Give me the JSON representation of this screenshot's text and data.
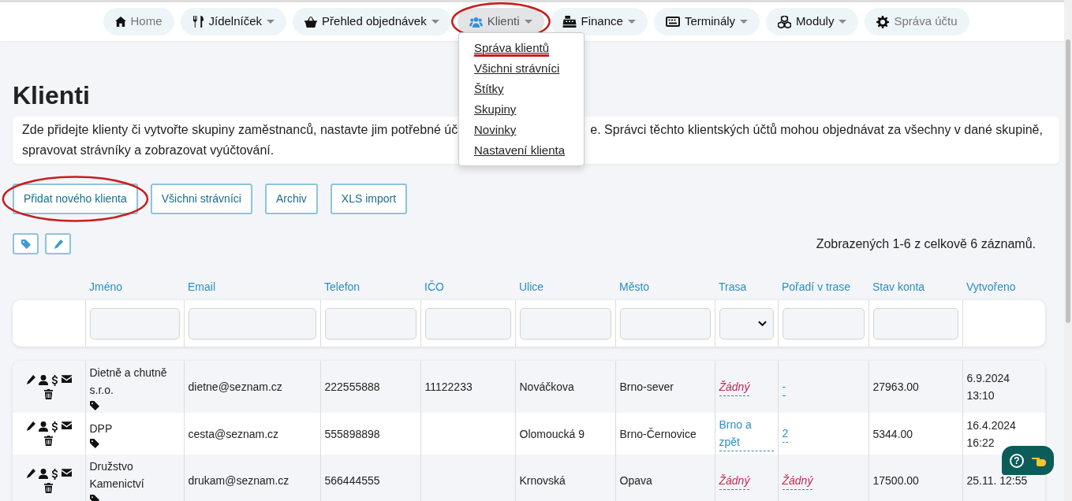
{
  "nav": [
    {
      "label": "Home",
      "dropdown": false,
      "dimmed": true,
      "selected": false,
      "annotated": false
    },
    {
      "label": "Jídelníček",
      "dropdown": true,
      "dimmed": false,
      "selected": false,
      "annotated": false
    },
    {
      "label": "Přehled objednávek",
      "dropdown": true,
      "dimmed": false,
      "selected": false,
      "annotated": false
    },
    {
      "label": "Klienti",
      "dropdown": true,
      "dimmed": false,
      "selected": true,
      "annotated": true
    },
    {
      "label": "Finance",
      "dropdown": true,
      "dimmed": false,
      "selected": false,
      "annotated": false
    },
    {
      "label": "Terminály",
      "dropdown": true,
      "dimmed": false,
      "selected": false,
      "annotated": false
    },
    {
      "label": "Moduly",
      "dropdown": true,
      "dimmed": false,
      "selected": false,
      "annotated": false
    },
    {
      "label": "Správa účtu",
      "dropdown": false,
      "dimmed": true,
      "selected": false,
      "annotated": false
    }
  ],
  "menu": [
    {
      "label": "Správa klientů",
      "annotated": true
    },
    {
      "label": "Všichni strávníci",
      "annotated": false
    },
    {
      "label": "Štítky",
      "annotated": false
    },
    {
      "label": "Skupiny",
      "annotated": false
    },
    {
      "label": "Novinky",
      "annotated": false
    },
    {
      "label": "Nastavení klienta",
      "annotated": false
    }
  ],
  "title": "Klienti",
  "intro": {
    "line1_left": "Zde přidejte klienty či vytvořte skupiny zaměstnanců, nastavte jim potřebné úč",
    "line1_right": "e. Správci těchto klientských účtů mohou objednávat za všechny v dané skupině,",
    "line2": "spravovat strávníky a zobrazovat vyúčtování."
  },
  "buttons": [
    {
      "label": "Přidat nového klienta",
      "annotated": true
    },
    {
      "label": "Všichni strávníci",
      "annotated": false
    },
    {
      "label": "Archiv",
      "annotated": false
    },
    {
      "label": "XLS import",
      "annotated": false
    }
  ],
  "record_count": "Zobrazených 1-6 z celkově 6 záznamů.",
  "columns": [
    {
      "label": "Jméno",
      "kind": "text"
    },
    {
      "label": "Email",
      "kind": "text"
    },
    {
      "label": "Telefon",
      "kind": "text"
    },
    {
      "label": "IČO",
      "kind": "text"
    },
    {
      "label": "Ulice",
      "kind": "text"
    },
    {
      "label": "Město",
      "kind": "text"
    },
    {
      "label": "Trasa",
      "kind": "select"
    },
    {
      "label": "Pořadí v trase",
      "kind": "text"
    },
    {
      "label": "Stav konta",
      "kind": "text"
    },
    {
      "label": "Vytvořeno",
      "kind": "none"
    }
  ],
  "rows": [
    {
      "name": "Dietně a chutně s.r.o.",
      "email": "dietne@seznam.cz",
      "phone": "222555888",
      "ico": "11122233",
      "street": "Nováčkova",
      "city": "Brno-sever",
      "route": {
        "text": "Žádný",
        "kind": "none"
      },
      "order": {
        "text": "-",
        "kind": "value"
      },
      "balance": "27963.00",
      "created": "6.9.2024 13:10"
    },
    {
      "name": "DPP",
      "email": "cesta@seznam.cz",
      "phone": "555898898",
      "ico": "",
      "street": "Olomoucká 9",
      "city": "Brno-Černovice",
      "route": {
        "text": "Brno a zpět",
        "kind": "value"
      },
      "order": {
        "text": "2",
        "kind": "value"
      },
      "balance": "5344.00",
      "created": "16.4.2024 16:22"
    },
    {
      "name": "Družstvo Kamenictví",
      "email": "drukam@seznam.cz",
      "phone": "566444555",
      "ico": "",
      "street": "Krnovská",
      "city": "Opava",
      "route": {
        "text": "Žádný",
        "kind": "none"
      },
      "order": {
        "text": "Žádný",
        "kind": "none"
      },
      "balance": "17500.00",
      "created": "25.11. 12:55"
    }
  ],
  "help": {
    "label": "?"
  }
}
